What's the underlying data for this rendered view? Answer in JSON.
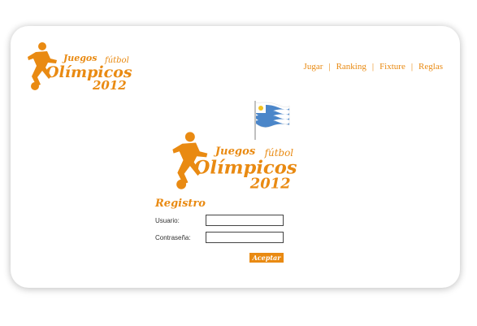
{
  "header": {
    "logo": {
      "line1": "Juegos",
      "line2": "fútbol",
      "line3": "Olímpicos",
      "year": "2012"
    },
    "nav": [
      {
        "label": "Jugar"
      },
      {
        "label": "Ranking"
      },
      {
        "label": "Fixture"
      },
      {
        "label": "Reglas"
      }
    ],
    "separator": "|"
  },
  "main": {
    "logo": {
      "line1": "Juegos",
      "line2": "fútbol",
      "line3": "Olímpicos",
      "year": "2012"
    },
    "flag_icon": "uruguay-flag-icon"
  },
  "form": {
    "title": "Registro",
    "username_label": "Usuario:",
    "username_value": "",
    "password_label": "Contraseña:",
    "password_value": "",
    "submit_label": "Aceptar"
  },
  "colors": {
    "accent": "#e98a12",
    "text": "#333333",
    "flag_blue": "#4b86c9"
  }
}
